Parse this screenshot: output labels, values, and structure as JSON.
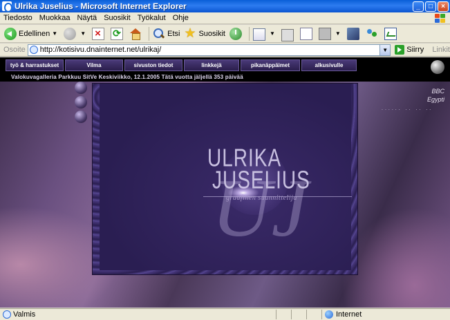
{
  "window": {
    "title": "Ulrika Juselius - Microsoft Internet Explorer",
    "minimize": "_",
    "maximize": "□",
    "close": "×"
  },
  "menu": [
    "Tiedosto",
    "Muokkaa",
    "Näytä",
    "Suosikit",
    "Työkalut",
    "Ohje"
  ],
  "toolbar": {
    "back_label": "Edellinen",
    "search_label": "Etsi",
    "favorites_label": "Suosikit"
  },
  "address": {
    "label": "Osoite",
    "url": "http://kotisivu.dnainternet.net/ulrikaj/",
    "go_label": "Siirry",
    "links_label": "Linkit"
  },
  "page": {
    "nav": [
      {
        "label": "työ & harrastukset"
      },
      {
        "label": "Vilma"
      },
      {
        "label": "sivuston tiedot"
      },
      {
        "label": "linkkejä"
      },
      {
        "label": "pikanäppäimet"
      },
      {
        "label": "alkusivulle"
      }
    ],
    "status_line": "Valokuvagalleria  Parkkuu  SitVe  Keskiviikko, 12.1.2005  Tätä vuotta jäljellä 353 päivää",
    "logo_first": "ULRIKA",
    "logo_last": "JUSELIUS",
    "logo_subtitle": "graafinen suunnittelija",
    "monogram": "UJ",
    "external_links": [
      "BBC",
      "Egypti"
    ],
    "dots": "......  ..  ..  .."
  },
  "status": {
    "text": "Valmis",
    "zone": "Internet"
  },
  "colors": {
    "titlebar": "#0a5fd8",
    "chrome": "#ece9d8",
    "page_bg": "#000000",
    "panel": "#2a1e52"
  }
}
